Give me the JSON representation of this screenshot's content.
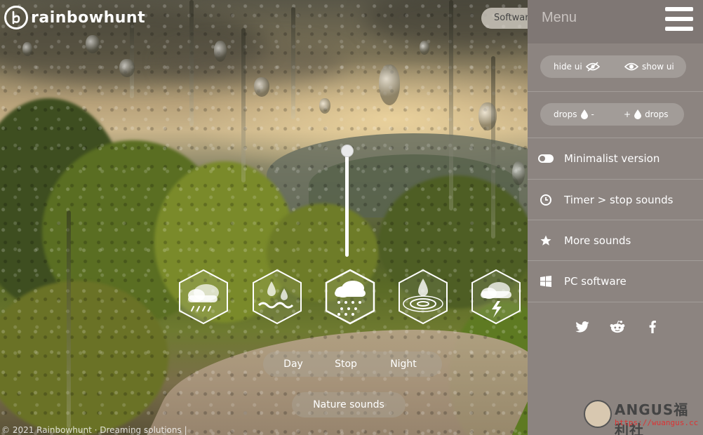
{
  "brand": {
    "name": "rainbowhunt"
  },
  "header": {
    "software_label": "Software"
  },
  "sounds": [
    {
      "name": "rain-thunder",
      "active": false
    },
    {
      "name": "rain-puddle",
      "active": false
    },
    {
      "name": "rain-cloud",
      "active": true
    },
    {
      "name": "drop-ripple",
      "active": false
    },
    {
      "name": "storm-lightning",
      "active": false
    }
  ],
  "volume": {
    "level": 1.0
  },
  "modes": {
    "day": "Day",
    "stop": "Stop",
    "night": "Night"
  },
  "nature_label": "Nature sounds",
  "footer": {
    "text": "© 2021 Rainbowhunt · Dreaming solutions | "
  },
  "menu": {
    "title": "Menu",
    "ui_toggle": {
      "hide_label": "hide ui",
      "show_label": "show ui"
    },
    "drops": {
      "less_label_left": "drops",
      "less_label_right": "-",
      "more_label_left": "+",
      "more_label_right": "drops"
    },
    "items": [
      {
        "label": "Minimalist version",
        "icon": "toggle-icon"
      },
      {
        "label": "Timer > stop sounds",
        "icon": "clock-icon"
      },
      {
        "label": "More sounds",
        "icon": "star-icon"
      },
      {
        "label": "PC software",
        "icon": "windows-icon"
      }
    ],
    "socials": [
      "twitter-icon",
      "reddit-icon",
      "facebook-icon"
    ]
  },
  "watermark": {
    "text": "ANGUS福利社",
    "url": "https://wuangus.cc"
  },
  "colors": {
    "menu_bg": "#8c8480",
    "menu_header": "#7f7774",
    "pill_bg": "#a29c98",
    "hex_stroke": "#ffffff"
  }
}
